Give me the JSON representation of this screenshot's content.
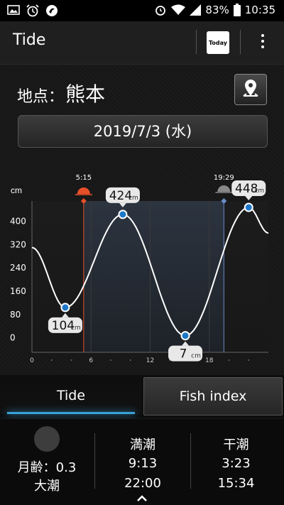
{
  "status_bar": {
    "battery": "83%",
    "time": "10:35"
  },
  "toolbar": {
    "title": "Tide",
    "today_label": "Today"
  },
  "location": {
    "label": "地点：",
    "name": "熊本"
  },
  "date": "2019/7/3 (水)",
  "chart_data": {
    "type": "line",
    "ylabel": "cm",
    "ylim": [
      -50,
      470
    ],
    "xlim": [
      0,
      24
    ],
    "yticks": [
      0,
      80,
      160,
      240,
      320,
      400
    ],
    "xticks": [
      0,
      6,
      12,
      18
    ],
    "sunrise": "5:15",
    "sunset": "19:29",
    "extremes": [
      {
        "time": 3.38,
        "value": 104,
        "type": "low",
        "label": "104",
        "unit": "cm"
      },
      {
        "time": 9.22,
        "value": 424,
        "type": "high",
        "label": "424",
        "unit": "cm"
      },
      {
        "time": 15.57,
        "value": 7,
        "type": "low",
        "label": "7",
        "unit": "cm"
      },
      {
        "time": 22.0,
        "value": 448,
        "type": "high",
        "label": "448",
        "unit": "cm"
      }
    ],
    "series": [
      {
        "x": [
          0,
          3.38,
          9.22,
          15.57,
          22.0,
          24
        ],
        "y": [
          310,
          104,
          424,
          7,
          448,
          360
        ]
      }
    ]
  },
  "tabs": {
    "tide": "Tide",
    "fish_index": "Fish index"
  },
  "bottom": {
    "moon_age": "月齢：0.3",
    "tide_name": "大潮",
    "high_title": "満潮",
    "high_times": [
      "9:13",
      "22:00"
    ],
    "low_title": "干潮",
    "low_times": [
      "3:23",
      "15:34"
    ]
  },
  "colors": {
    "accent": "#3aa3d8",
    "sunrise": "#e8502a",
    "sunset_line": "#6a8cc9"
  }
}
